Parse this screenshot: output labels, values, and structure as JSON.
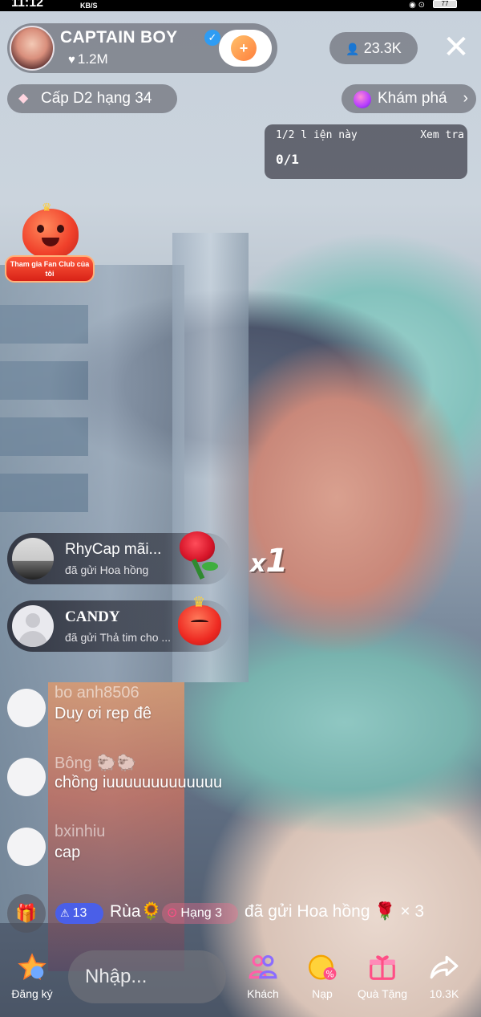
{
  "status_bar": {
    "time": "11:12",
    "network": "KB/S",
    "battery": "77"
  },
  "streamer": {
    "name": "CAPTAIN BOY",
    "likes": "1.2M"
  },
  "viewers": "23.3K",
  "rank_badge": "Cấp D2 hạng 34",
  "explore": {
    "label": "Khám phá",
    "chevron": "›"
  },
  "info_card": {
    "line1": "1/2 l iện này",
    "more": "Xem tra",
    "line2": "0/1"
  },
  "fan_club": {
    "label": "Tham gia Fan Club của tôi"
  },
  "gift_notifications": [
    {
      "user": "RhyCap mãi...",
      "action": "đã gửi Hoa hồng"
    },
    {
      "user": "CANDY",
      "action": "đã gửi Thả tim cho ..."
    }
  ],
  "combo": {
    "x": "x",
    "count": "1"
  },
  "chat": [
    {
      "user": "bo anh8506",
      "text": "Duy ơi rep đê"
    },
    {
      "user": "Bông 🐑🐑",
      "text": "chồng iuuuuuuuuuuuuu"
    },
    {
      "user": "bxinhiu",
      "text": "cap"
    }
  ],
  "gift_line": {
    "level": "13",
    "user": "Rùa🌻",
    "rank": "Hạng 3",
    "action": "đã gửi Hoa hồng 🌹 × 3"
  },
  "bottom_bar": {
    "register": "Đăng ký",
    "input_placeholder": "Nhập...",
    "guests": "Khách",
    "topup": "Nạp",
    "gift": "Quà Tặng",
    "share_count": "10.3K"
  },
  "colors": {
    "verified": "#2f9cf3",
    "level_badge": "#4a5fe8",
    "rank_badge": "#ff4f86",
    "fan_club": "#e82a1e"
  }
}
